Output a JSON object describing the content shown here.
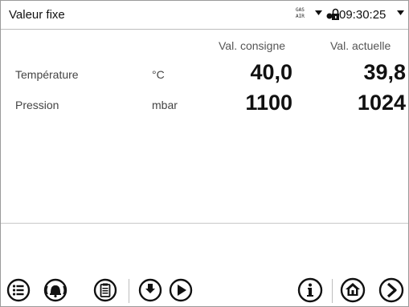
{
  "statusbar": {
    "title": "Valeur fixe",
    "gas_label": "GAS",
    "air_label": "AIR",
    "time": "09:30:25"
  },
  "table": {
    "col_setpoint": "Val. consigne",
    "col_actual": "Val. actuelle",
    "rows": [
      {
        "label": "Température",
        "unit": "°C",
        "setpoint": "40,0",
        "actual": "39,8"
      },
      {
        "label": "Pression",
        "unit": "mbar",
        "setpoint": "1100",
        "actual": "1024"
      }
    ]
  },
  "toolbar": {
    "icons": [
      "menu-list-icon",
      "alarm-bell-icon",
      "clipboard-icon",
      "program-hand-icon",
      "play-icon",
      "info-icon",
      "home-icon",
      "next-arrow-icon"
    ]
  }
}
